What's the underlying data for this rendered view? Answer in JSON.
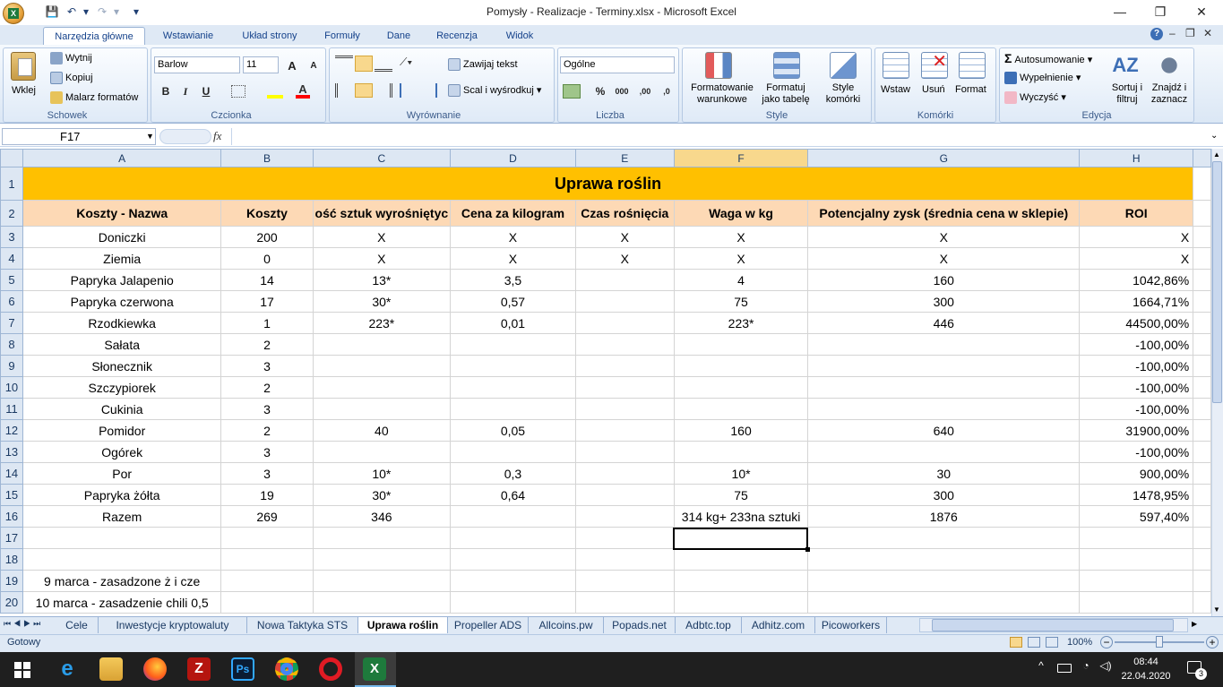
{
  "window": {
    "title": "Pomysły - Realizacje - Terminy.xlsx - Microsoft Excel",
    "minimize": "—",
    "restore": "❐",
    "close": "✕"
  },
  "qat": {
    "save": "💾",
    "undo": "↶",
    "redo": "↷",
    "customize": "▾"
  },
  "ribbon_tabs": [
    "Narzędzia główne",
    "Wstawianie",
    "Układ strony",
    "Formuły",
    "Dane",
    "Recenzja",
    "Widok"
  ],
  "help": {
    "help": "?",
    "minimize": "–",
    "restore": "❐",
    "close": "✕"
  },
  "clipboard": {
    "paste": "Wklej",
    "cut": "Wytnij",
    "copy": "Kopiuj",
    "format_painter": "Malarz formatów",
    "group": "Schowek"
  },
  "font": {
    "name": "Barlow",
    "size": "11",
    "bold": "B",
    "italic": "I",
    "underline": "U",
    "grow": "A",
    "shrink": "A",
    "group": "Czcionka"
  },
  "alignment": {
    "wrap": "Zawijaj tekst",
    "merge": "Scal i wyśrodkuj",
    "group": "Wyrównanie"
  },
  "number": {
    "format": "Ogólne",
    "percent": "%",
    "thousands": "000",
    "inc_dec": ",00",
    "dec_dec": ",0",
    "group": "Liczba"
  },
  "styles": {
    "conditional": "Formatowanie\nwarunkowe",
    "table": "Formatuj\njako tabelę",
    "cell": "Style\nkomórki",
    "group": "Style"
  },
  "cells": {
    "insert": "Wstaw",
    "delete": "Usuń",
    "format": "Format",
    "group": "Komórki"
  },
  "editing": {
    "autosum": "Autosumowanie",
    "fill": "Wypełnienie",
    "clear": "Wyczyść",
    "sort": "Sortuj i\nfiltruj",
    "find": "Znajdź i\nzaznacz",
    "group": "Edycja"
  },
  "formula_bar": {
    "name_box": "F17",
    "fx": "fx",
    "formula": ""
  },
  "columns": [
    "A",
    "B",
    "C",
    "D",
    "E",
    "F",
    "G",
    "H"
  ],
  "selected_column": "F",
  "sheet": {
    "title": "Uprawa roślin",
    "headers": [
      "Koszty - Nazwa",
      "Koszty",
      "ość sztuk wyrośniętyc",
      "Cena za kilogram",
      "Czas rośnięcia",
      "Waga w kg",
      "Potencjalny zysk (średnia cena w sklepie)",
      "ROI"
    ],
    "rows": [
      {
        "n": "3",
        "c": [
          "Doniczki",
          "200",
          "X",
          "X",
          "X",
          "X",
          "X",
          "X"
        ]
      },
      {
        "n": "4",
        "c": [
          "Ziemia",
          "0",
          "X",
          "X",
          "X",
          "X",
          "X",
          "X"
        ]
      },
      {
        "n": "5",
        "c": [
          "Papryka Jalapenio",
          "14",
          "13*",
          "3,5",
          "",
          "4",
          "160",
          "1042,86%"
        ]
      },
      {
        "n": "6",
        "c": [
          "Papryka czerwona",
          "17",
          "30*",
          "0,57",
          "",
          "75",
          "300",
          "1664,71%"
        ]
      },
      {
        "n": "7",
        "c": [
          "Rzodkiewka",
          "1",
          "223*",
          "0,01",
          "",
          "223*",
          "446",
          "44500,00%"
        ]
      },
      {
        "n": "8",
        "c": [
          "Sałata",
          "2",
          "",
          "",
          "",
          "",
          "",
          "-100,00%"
        ]
      },
      {
        "n": "9",
        "c": [
          "Słonecznik",
          "3",
          "",
          "",
          "",
          "",
          "",
          "-100,00%"
        ]
      },
      {
        "n": "10",
        "c": [
          "Szczypiorek",
          "2",
          "",
          "",
          "",
          "",
          "",
          "-100,00%"
        ]
      },
      {
        "n": "11",
        "c": [
          "Cukinia",
          "3",
          "",
          "",
          "",
          "",
          "",
          "-100,00%"
        ]
      },
      {
        "n": "12",
        "c": [
          "Pomidor",
          "2",
          "40",
          "0,05",
          "",
          "160",
          "640",
          "31900,00%"
        ]
      },
      {
        "n": "13",
        "c": [
          "Ogórek",
          "3",
          "",
          "",
          "",
          "",
          "",
          "-100,00%"
        ]
      },
      {
        "n": "14",
        "c": [
          "Por",
          "3",
          "10*",
          "0,3",
          "",
          "10*",
          "30",
          "900,00%"
        ]
      },
      {
        "n": "15",
        "c": [
          "Papryka żółta",
          "19",
          "30*",
          "0,64",
          "",
          "75",
          "300",
          "1478,95%"
        ]
      },
      {
        "n": "16",
        "c": [
          "Razem",
          "269",
          "346",
          "",
          "",
          "314 kg+ 233na sztuki",
          "1876",
          "597,40%"
        ]
      },
      {
        "n": "17",
        "c": [
          "",
          "",
          "",
          "",
          "",
          "",
          "",
          ""
        ]
      },
      {
        "n": "18",
        "c": [
          "",
          "",
          "",
          "",
          "",
          "",
          "",
          ""
        ]
      },
      {
        "n": "19",
        "c": [
          "9 marca - zasadzone ż i cze",
          "",
          "",
          "",
          "",
          "",
          "",
          ""
        ]
      },
      {
        "n": "20",
        "c": [
          "10 marca - zasadzenie chili 0,5",
          "",
          "",
          "",
          "",
          "",
          "",
          ""
        ]
      }
    ]
  },
  "sheet_tabs": [
    "Cele",
    "Inwestycje kryptowaluty",
    "Nowa Taktyka STS",
    "Uprawa roślin",
    "Propeller ADS",
    "Allcoins.pw",
    "Popads.net",
    "Adbtc.top",
    "Adhitz.com",
    "Picoworkers"
  ],
  "active_sheet": "Uprawa roślin",
  "status": {
    "ready": "Gotowy",
    "zoom": "100%"
  },
  "taskbar": {
    "time": "08:44",
    "date": "22.04.2020",
    "notifications": "3"
  }
}
